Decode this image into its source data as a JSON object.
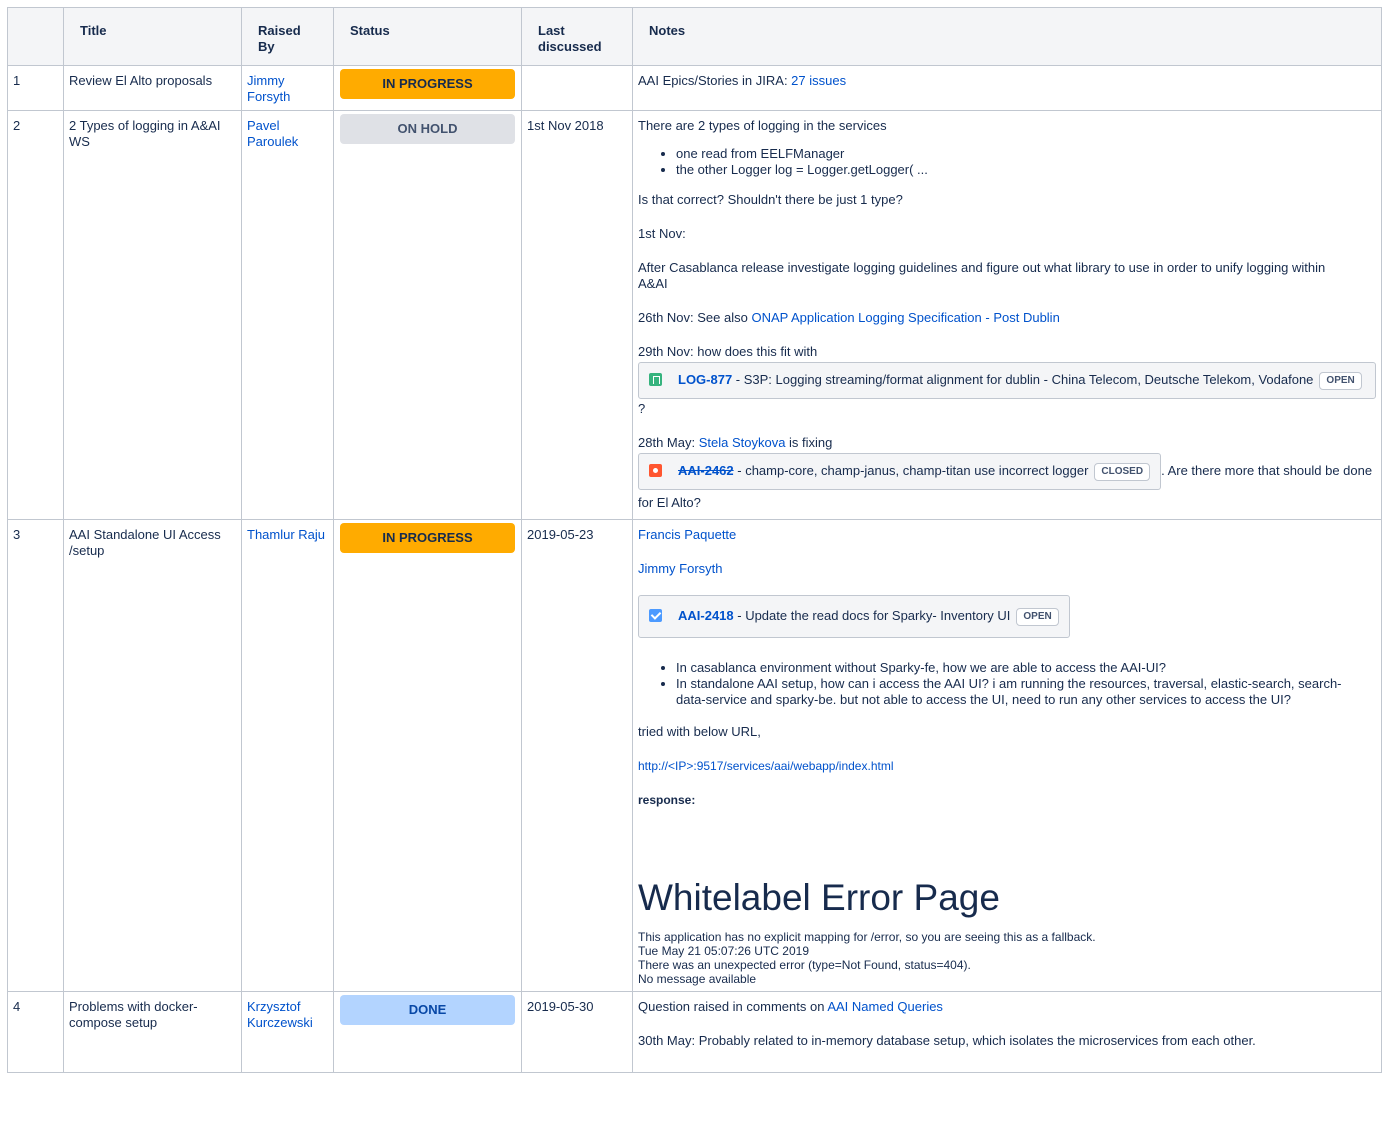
{
  "headers": [
    "",
    "Title",
    "Raised By",
    "Status",
    "Last discussed",
    "Notes"
  ],
  "rows": [
    {
      "num": "1",
      "title": "Review El Alto proposals",
      "raised_by": "Jimmy Forsyth",
      "status": "IN PROGRESS",
      "last_discussed": "",
      "notes": {
        "prefix": "AAI Epics/Stories in JIRA: ",
        "link": "27 issues"
      }
    },
    {
      "num": "2",
      "title": "2 Types of logging in A&AI WS",
      "raised_by": "Pavel Paroulek",
      "status": "ON HOLD",
      "last_discussed": "1st Nov 2018",
      "notes": {
        "p1": "There are 2 types of logging in the services",
        "bullets": [
          "one read from EELFManager",
          "the other Logger log = Logger.getLogger( ..."
        ],
        "p2": "Is that correct? Shouldn't there be just 1 type?",
        "p3": "1st Nov:",
        "p4": "After Casablanca release investigate logging guidelines and figure out what library to use in order to unify logging within A&AI",
        "p5_prefix": "26th Nov: See also ",
        "p5_link": "ONAP Application Logging Specification - Post Dublin",
        "p6": "29th Nov: how does this fit with",
        "jira1": {
          "key": "LOG-877",
          "summary": " - S3P: Logging streaming/format alignment for dublin - China Telecom, Deutsche Telekom, Vodafone",
          "status": "OPEN"
        },
        "q": "?",
        "p7_prefix": "28th May: ",
        "p7_link": "Stela Stoykova",
        "p7_suffix": " is fixing",
        "jira2": {
          "key": "AAI-2462",
          "summary": " - champ-core, champ-janus, champ-titan use incorrect logger",
          "status": "CLOSED"
        },
        "p8": ". Are there more that should be done for El Alto?"
      }
    },
    {
      "num": "3",
      "title": "AAI Standalone UI Access /setup",
      "raised_by": "Thamlur Raju",
      "status": "IN PROGRESS",
      "last_discussed": "2019-05-23",
      "notes": {
        "mention1": "Francis Paquette",
        "mention2": "Jimmy Forsyth",
        "jira": {
          "key": "AAI-2418",
          "summary": " - Update the read docs for Sparky- Inventory UI",
          "status": "OPEN"
        },
        "bullets": [
          "In casablanca environment without Sparky-fe, how we are able to access the AAI-UI?",
          "In standalone AAI setup, how can i access the AAI UI? i am running the resources, traversal, elastic-search, search-data-service and sparky-be. but not able to access the UI, need to run any other services to access the UI?"
        ],
        "p1": "tried with below URL,",
        "url": "http://<IP>:9517/services/aai/webapp/index.html",
        "response": "response:",
        "wl_title": "Whitelabel Error Page",
        "wl_lines": [
          "This application has no explicit mapping for /error, so you are seeing this as a fallback.",
          "Tue May 21 05:07:26 UTC 2019",
          "There was an unexpected error (type=Not Found, status=404).",
          "No message available"
        ]
      }
    },
    {
      "num": "4",
      "title": "Problems with docker-compose setup",
      "raised_by": "Krzysztof Kurczewski",
      "status": "DONE",
      "last_discussed": "2019-05-30",
      "notes": {
        "p1_prefix": "Question raised in comments on ",
        "p1_link": "AAI Named Queries",
        "p2": "30th May: Probably related to in-memory database setup, which isolates the microservices from each other."
      }
    }
  ],
  "colors": {
    "in_progress": "#ffab00",
    "on_hold": "#dfe1e6",
    "done": "#b3d4ff",
    "link": "#0052cc"
  }
}
